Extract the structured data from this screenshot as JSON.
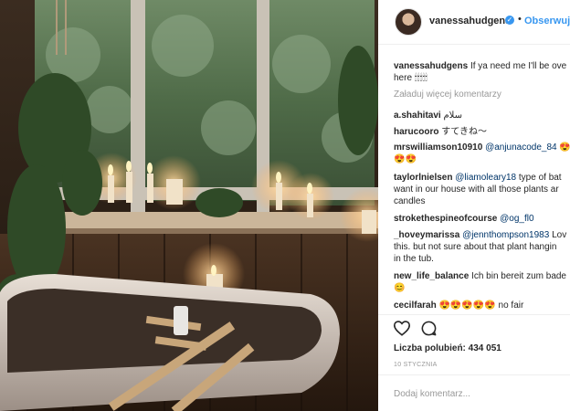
{
  "post": {
    "username": "vanessahudgens",
    "follow_label": "Obserwuj",
    "dot": "•",
    "verified_mark": "✓",
    "caption_user": "vanessahudgens",
    "caption_line1": "If ya need me I'll be ove",
    "caption_line2": "here 🕯🕯🕯🕯🕯"
  },
  "load_more": "Załaduj więcej komentarzy",
  "comments": [
    {
      "user": "a.shahitavi",
      "lines": [
        "سلام"
      ]
    },
    {
      "user": "harucooro",
      "lines": [
        "すてきね〜"
      ]
    },
    {
      "user": "mrswilliamson10910",
      "mention": "@anjunacode_84",
      "lines": [
        "😍😍😍",
        "😍😍"
      ]
    },
    {
      "user": "taylorlnielsen",
      "mention": "@liamoleary18",
      "lines": [
        "type of bat",
        "want in our house with all those plants ar",
        "candles"
      ]
    },
    {
      "user": "strokethespineofcourse",
      "mention": "@og_fl0",
      "lines": [
        ""
      ]
    },
    {
      "user": "_hoveymarissa",
      "mention": "@jennthompson1983",
      "lines": [
        "Lov",
        "this. but not sure about that plant hangin",
        "in the tub."
      ]
    },
    {
      "user": "new_life_balance",
      "lines": [
        "Ich bin bereit zum bade",
        "😊"
      ]
    },
    {
      "user": "cecilfarah",
      "lines": [
        "😍😍😍😍😍 no fair"
      ]
    }
  ],
  "likes_label": "Liczba polubień: 434 051",
  "date": "10 STYCZNIA",
  "add_comment_placeholder": "Dodaj komentarz...",
  "icons": {
    "like": "heart-icon",
    "comment": "comment-bubble-icon"
  },
  "colors": {
    "link": "#3897f0",
    "mention": "#003569",
    "muted": "#999999"
  }
}
